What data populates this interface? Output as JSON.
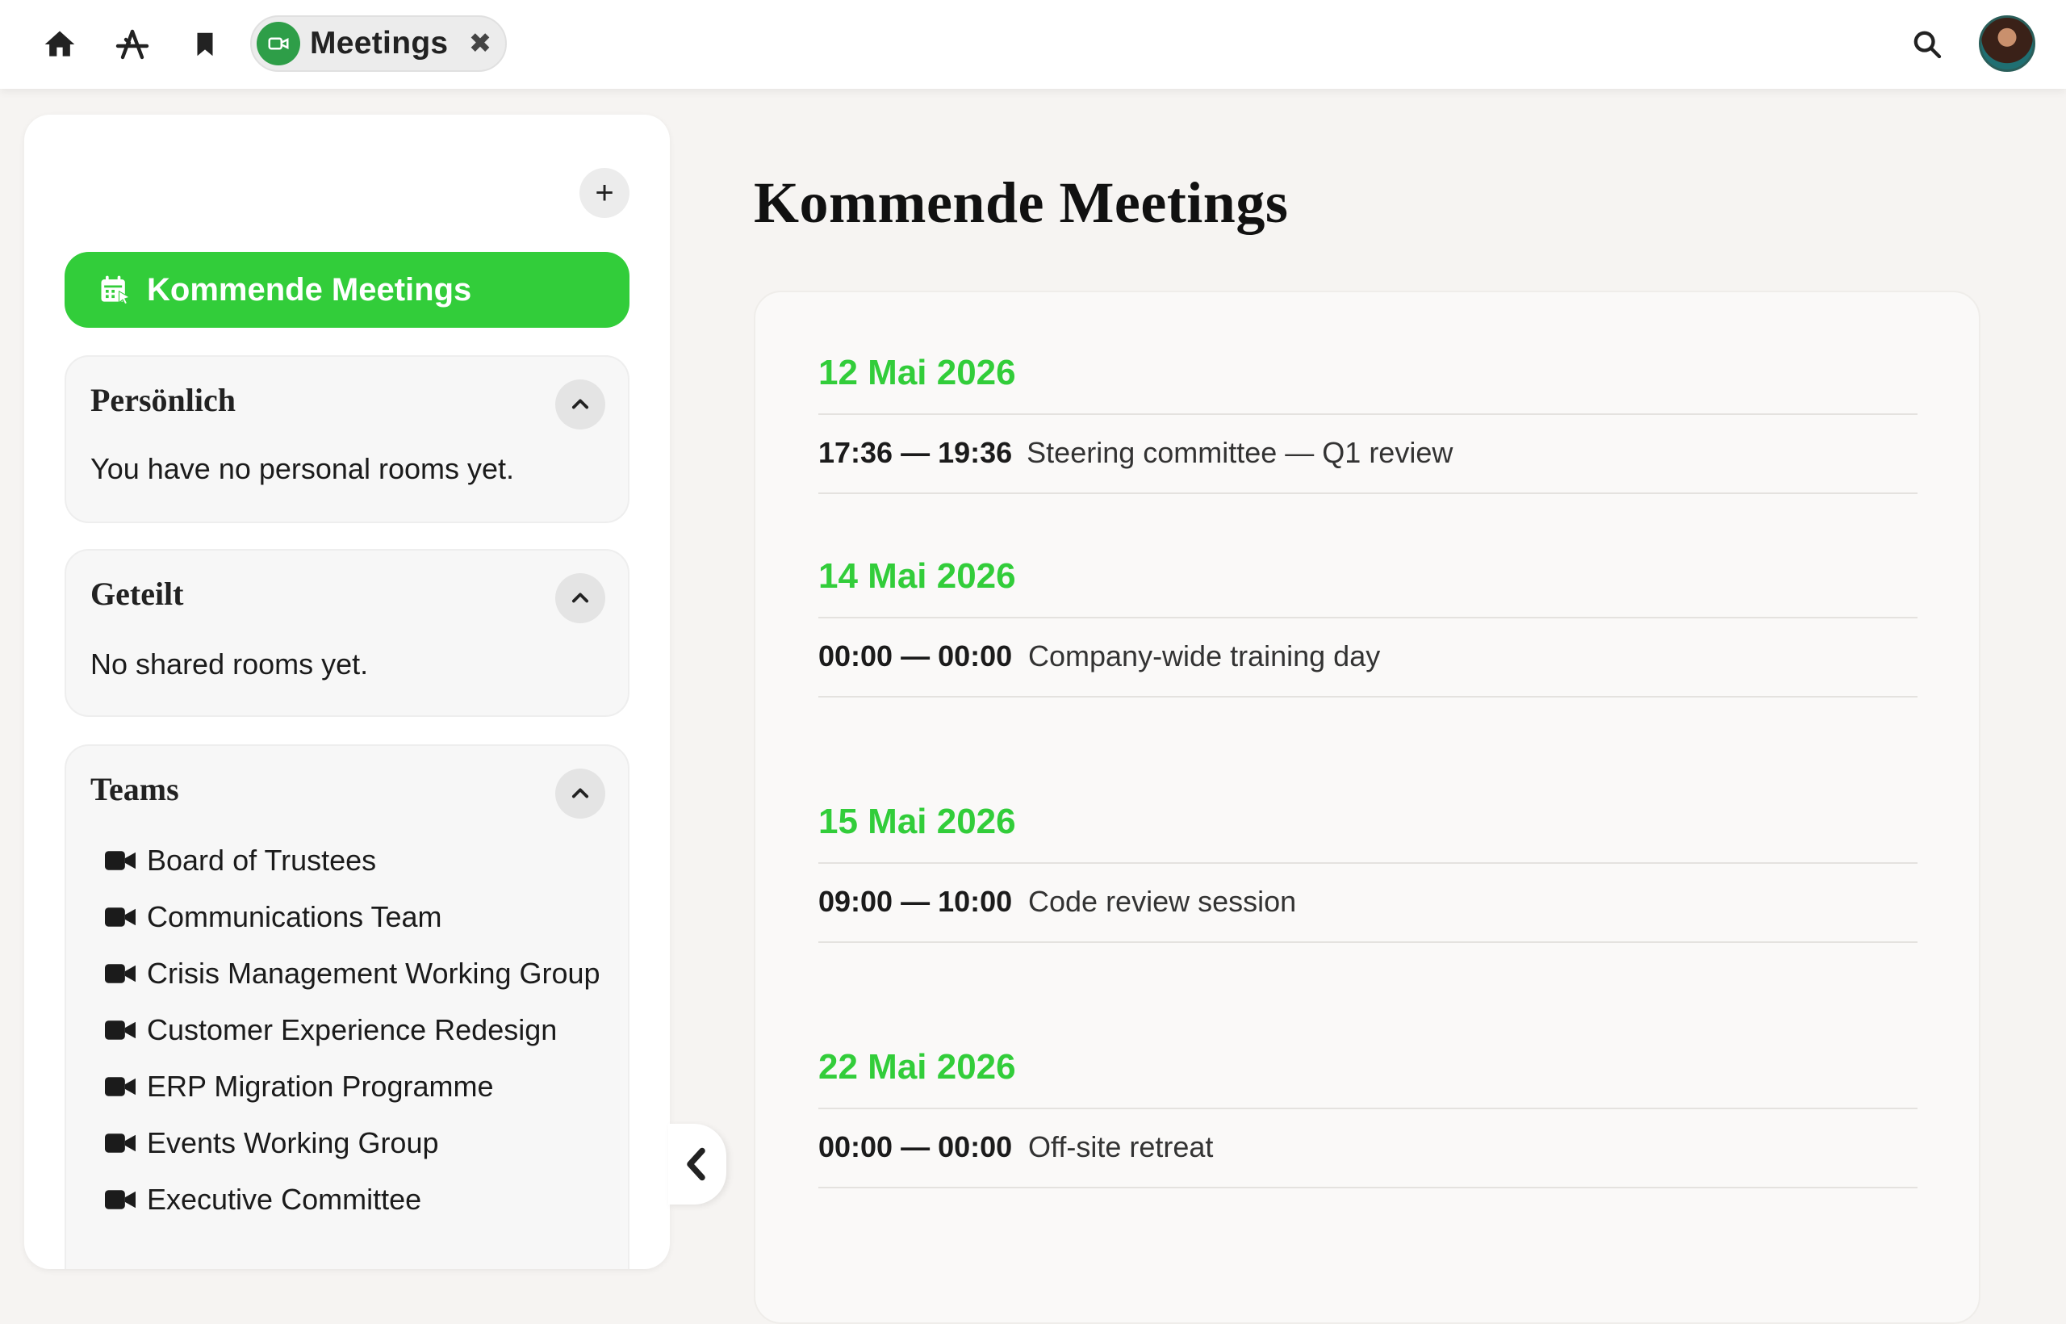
{
  "topbar": {
    "nav_icons": [
      "home-icon",
      "apps-icon",
      "bookmark-icon"
    ],
    "app_tab": {
      "label": "Meetings",
      "icon": "video-camera-icon",
      "close_glyph": "✖"
    },
    "search_icon": "search-icon",
    "avatar": "user-avatar"
  },
  "colors": {
    "accent": "#32cd3a",
    "app_icon": "#2e9e48",
    "background": "#f6f4f2"
  },
  "sidebar": {
    "add_glyph": "+",
    "primary_nav": {
      "label": "Kommende Meetings",
      "icon": "calendar-icon"
    },
    "sections": {
      "personal": {
        "title": "Persönlich",
        "empty_text": "You have no personal rooms yet."
      },
      "shared": {
        "title": "Geteilt",
        "empty_text": "No shared rooms yet."
      },
      "teams": {
        "title": "Teams",
        "items": [
          "Board of Trustees",
          "Communications Team",
          "Crisis Management Working Group",
          "Customer Experience Redesign",
          "ERP Migration Programme",
          "Events Working Group",
          "Executive Committee"
        ]
      }
    }
  },
  "main": {
    "title": "Kommende Meetings",
    "days": [
      {
        "date": "12 Mai 2026",
        "meetings": [
          {
            "time": "17:36 — 19:36",
            "title": "Steering committee — Q1 review"
          }
        ]
      },
      {
        "date": "14 Mai 2026",
        "meetings": [
          {
            "time": "00:00 — 00:00",
            "title": "Company-wide training day"
          }
        ]
      },
      {
        "date": "15 Mai 2026",
        "meetings": [
          {
            "time": "09:00 — 10:00",
            "title": "Code review session"
          }
        ]
      },
      {
        "date": "22 Mai 2026",
        "meetings": [
          {
            "time": "00:00 — 00:00",
            "title": "Off-site retreat"
          }
        ]
      }
    ]
  }
}
